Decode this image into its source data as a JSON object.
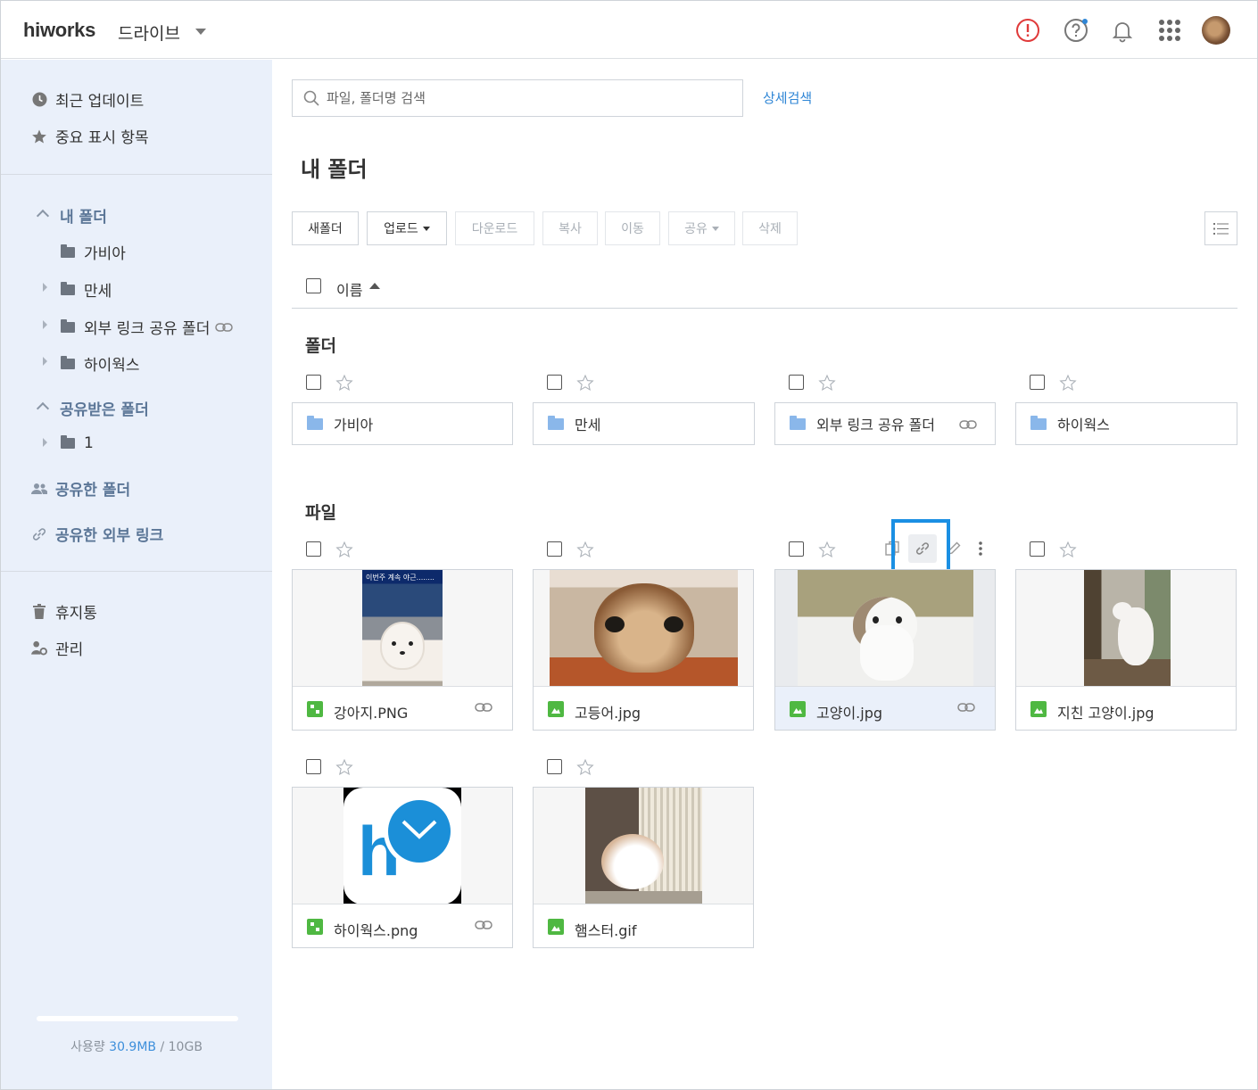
{
  "header": {
    "logo": "hiworks",
    "app_name": "드라이브",
    "icons": [
      "alert-icon",
      "help-icon",
      "bell-icon",
      "apps-grid-icon",
      "avatar"
    ]
  },
  "sidebar": {
    "top_items": [
      {
        "label": "최근 업데이트",
        "icon": "clock-icon"
      },
      {
        "label": "중요 표시 항목",
        "icon": "star-icon"
      }
    ],
    "my_folder": {
      "title": "내 폴더",
      "items": [
        "가비아",
        "만세",
        "외부 링크 공유 폴더",
        "하이웍스"
      ]
    },
    "shared_received": {
      "title": "공유받은 폴더",
      "items": [
        "1"
      ]
    },
    "shared_folder": "공유한 폴더",
    "shared_link": "공유한 외부 링크",
    "trash": "휴지통",
    "admin": "관리",
    "usage": {
      "label": "사용량",
      "used": "30.9MB",
      "total": "/ 10GB"
    }
  },
  "search": {
    "placeholder": "파일, 폴더명 검색",
    "advanced": "상세검색"
  },
  "page_title": "내 폴더",
  "toolbar": {
    "new_folder": "새폴더",
    "upload": "업로드",
    "download": "다운로드",
    "copy": "복사",
    "move": "이동",
    "share": "공유",
    "delete": "삭제"
  },
  "list_header": {
    "name": "이름"
  },
  "folders_section": {
    "title": "폴더",
    "items": [
      {
        "name": "가비아",
        "shared_link": false
      },
      {
        "name": "만세",
        "shared_link": false
      },
      {
        "name": "외부 링크 공유 폴더",
        "shared_link": true
      },
      {
        "name": "하이웍스",
        "shared_link": false
      }
    ]
  },
  "files_section": {
    "title": "파일",
    "items": [
      {
        "name": "강아지.PNG",
        "type": "png",
        "shared_link": true
      },
      {
        "name": "고등어.jpg",
        "type": "jpg",
        "shared_link": false
      },
      {
        "name": "고양이.jpg",
        "type": "jpg",
        "shared_link": true,
        "selected": true
      },
      {
        "name": "지친 고양이.jpg",
        "type": "jpg",
        "shared_link": false
      },
      {
        "name": "하이웍스.png",
        "type": "png",
        "shared_link": true
      },
      {
        "name": "햄스터.gif",
        "type": "gif",
        "shared_link": false
      }
    ],
    "thumb_caption": "이번주 계속 야근........"
  },
  "colors": {
    "accent": "#2f86d6",
    "highlight_box": "#1a8fe3",
    "sidebar_bg": "#eaf0fa",
    "file_icon": "#4fb842",
    "folder_icon": "#8ab7ea"
  }
}
